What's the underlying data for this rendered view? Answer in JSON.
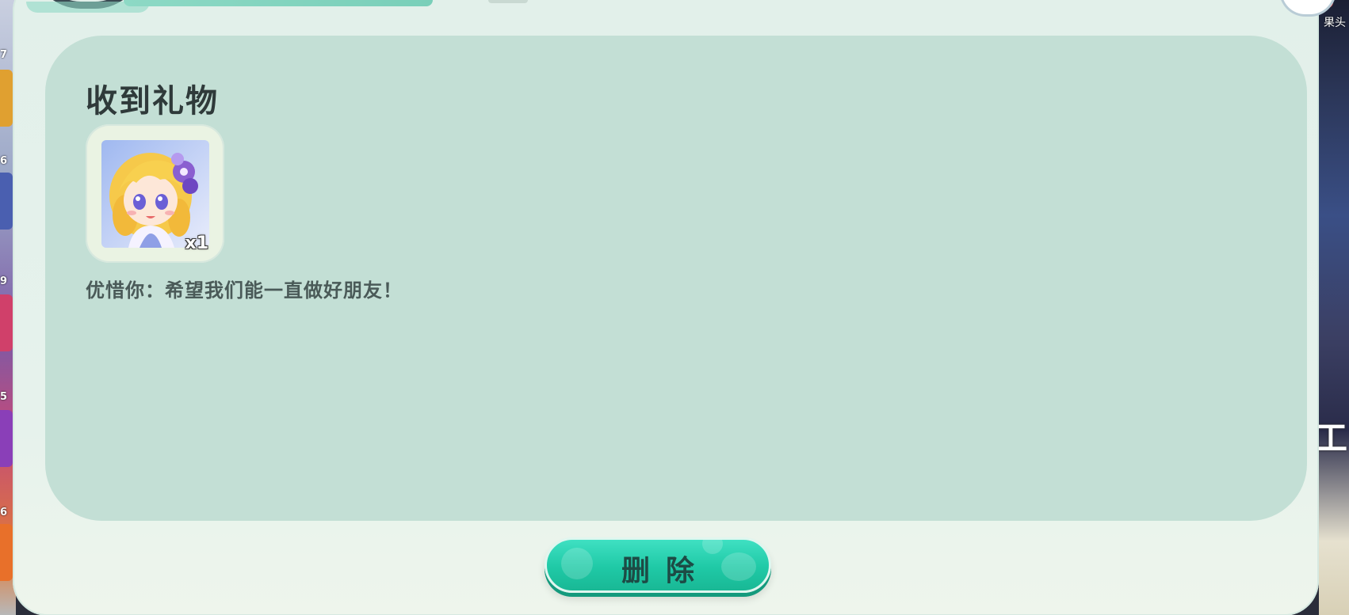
{
  "background": {
    "left_numbers": [
      "7",
      "6",
      "9",
      "5",
      "6"
    ],
    "right_label": "果头",
    "right_glyph": "工"
  },
  "dialog": {
    "title": "收到礼物",
    "gift": {
      "icon": "anime-girl-avatar-icon",
      "count": "x1"
    },
    "message": "优惜你：希望我们能一直做好朋友！",
    "delete_label": "删除"
  },
  "colors": {
    "card_bg": "#c3dfd5",
    "dialog_bg": "#e2f0ea",
    "button": "#1fc9a6",
    "title": "#2f3a3a"
  }
}
